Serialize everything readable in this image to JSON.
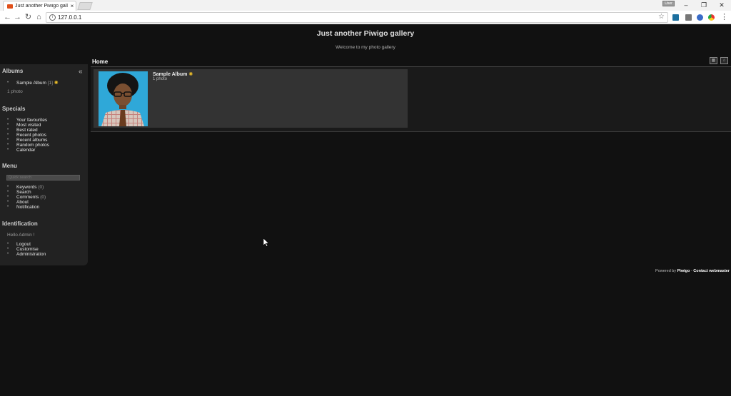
{
  "browser": {
    "tab_title": "Just another Piwigo gall",
    "tab_close": "×",
    "url": "127.0.0.1",
    "user_badge": "User",
    "win_minimize": "–",
    "win_restore": "❐",
    "win_close": "✕",
    "menu_dots": "⋮"
  },
  "site": {
    "title": "Just another Piwigo gallery",
    "subtitle": "Welcome to my photo gallery"
  },
  "menubar": {
    "albums": {
      "heading": "Albums",
      "item_label": "Sample Album",
      "item_count": "[1]",
      "summary": "1 photo"
    },
    "specials": {
      "heading": "Specials",
      "items": [
        "Your favourites",
        "Most visited",
        "Best rated",
        "Recent photos",
        "Recent albums",
        "Random photos",
        "Calendar"
      ]
    },
    "menu": {
      "heading": "Menu",
      "search_placeholder": "Quick search",
      "keywords": "Keywords",
      "keywords_count": "(0)",
      "search": "Search",
      "comments": "Comments",
      "comments_count": "(0)",
      "about": "About",
      "notification": "Notification"
    },
    "identification": {
      "heading": "Identification",
      "greeting": "Hello Admin !",
      "items": [
        "Logout",
        "Customise",
        "Administration"
      ]
    }
  },
  "content": {
    "title": "Home",
    "album": {
      "name": "Sample Album",
      "count": "1 photo"
    }
  },
  "footer": {
    "powered_by": "Powered by",
    "piwigo": "Piwigo",
    "separator": " - ",
    "contact": "Contact webmaster"
  },
  "colors": {
    "page_bg": "#111111",
    "menu_bg": "#222222",
    "card_bg": "#333333",
    "recent_star": "#f2c22a"
  }
}
